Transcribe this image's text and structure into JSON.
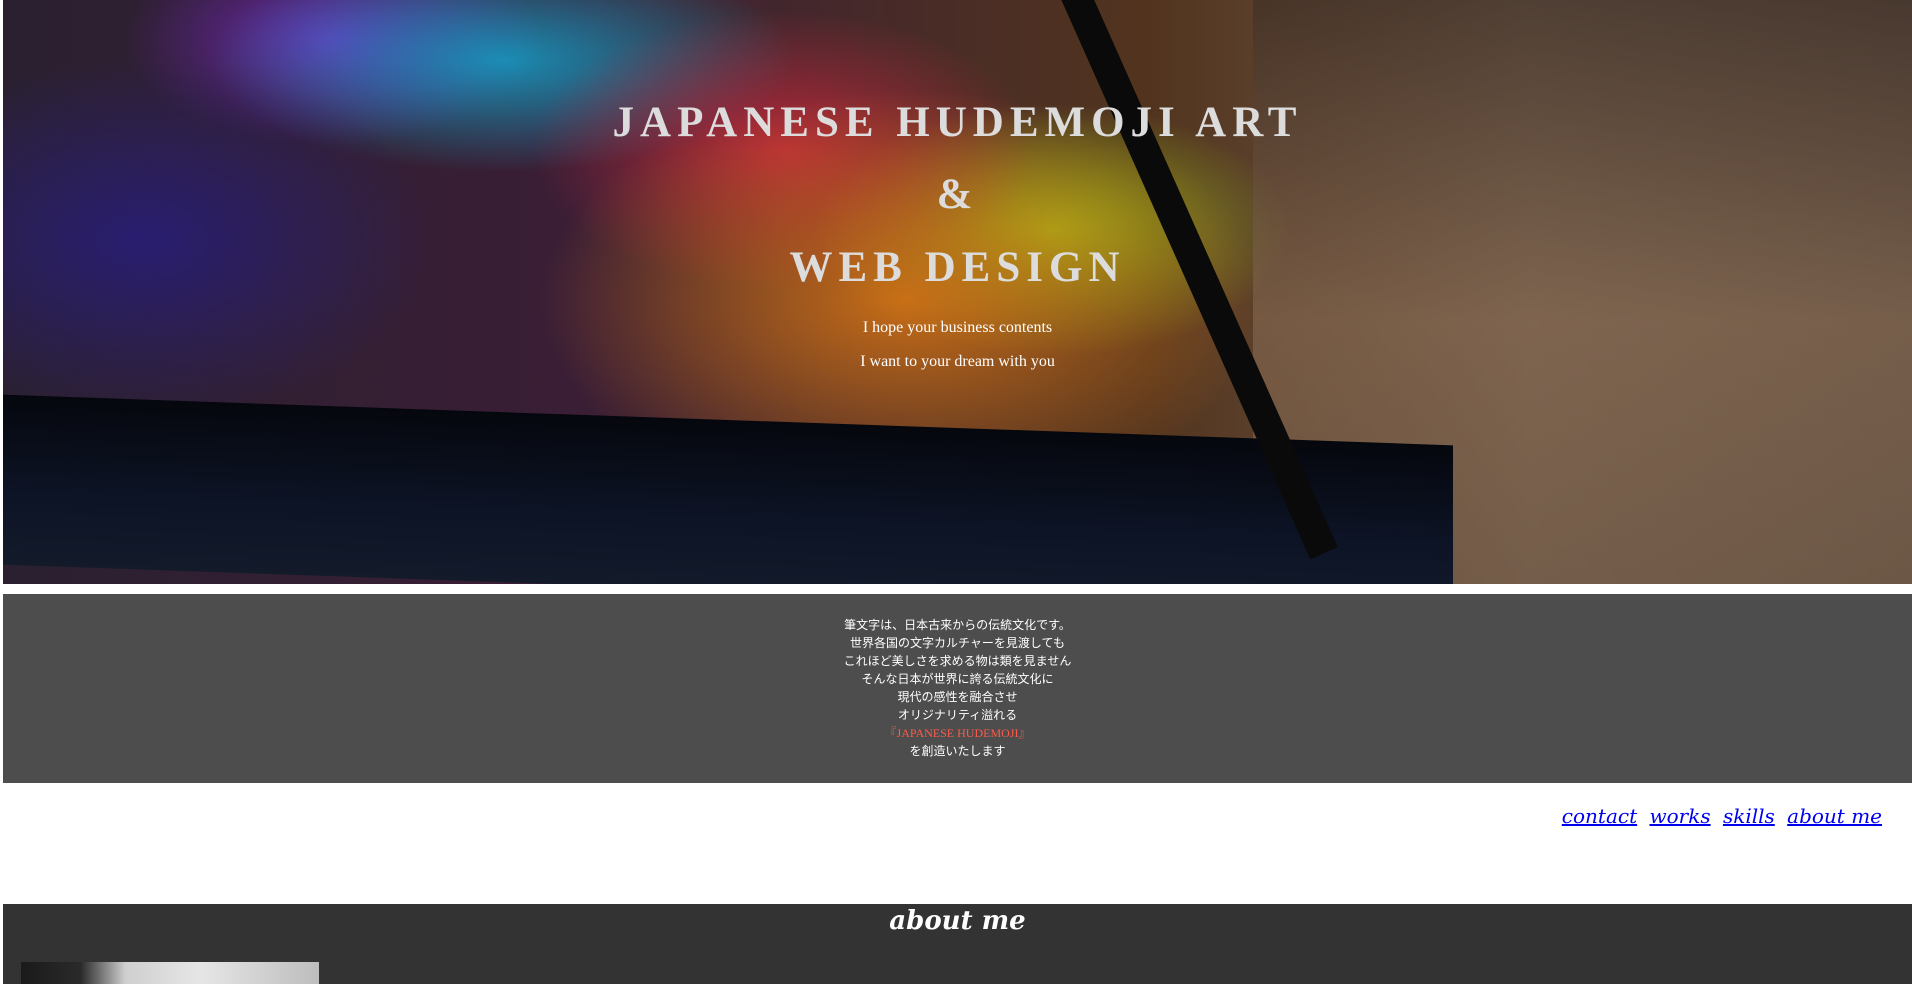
{
  "hero": {
    "title_line1": "JAPANESE HUDEMOJI ART",
    "title_line2": "&",
    "title_line3": "WEB DESIGN",
    "subtitle1": "I hope your business contents",
    "subtitle2": "I want to your dream with you"
  },
  "intro": {
    "lines": [
      "筆文字は、日本古来からの伝統文化です。",
      "世界各国の文字カルチャーを見渡しても",
      "これほど美しさを求める物は類を見ません",
      "そんな日本が世界に誇る伝統文化に",
      "現代の感性を融合させ",
      "オリジナリティ溢れる",
      "『JAPANESE HUDEMOJI』",
      "を創造いたします"
    ],
    "accent_color": "#ff5a4a"
  },
  "nav": {
    "items": [
      "contact",
      "works",
      "skills",
      "about me"
    ]
  },
  "about": {
    "heading": "about me"
  }
}
